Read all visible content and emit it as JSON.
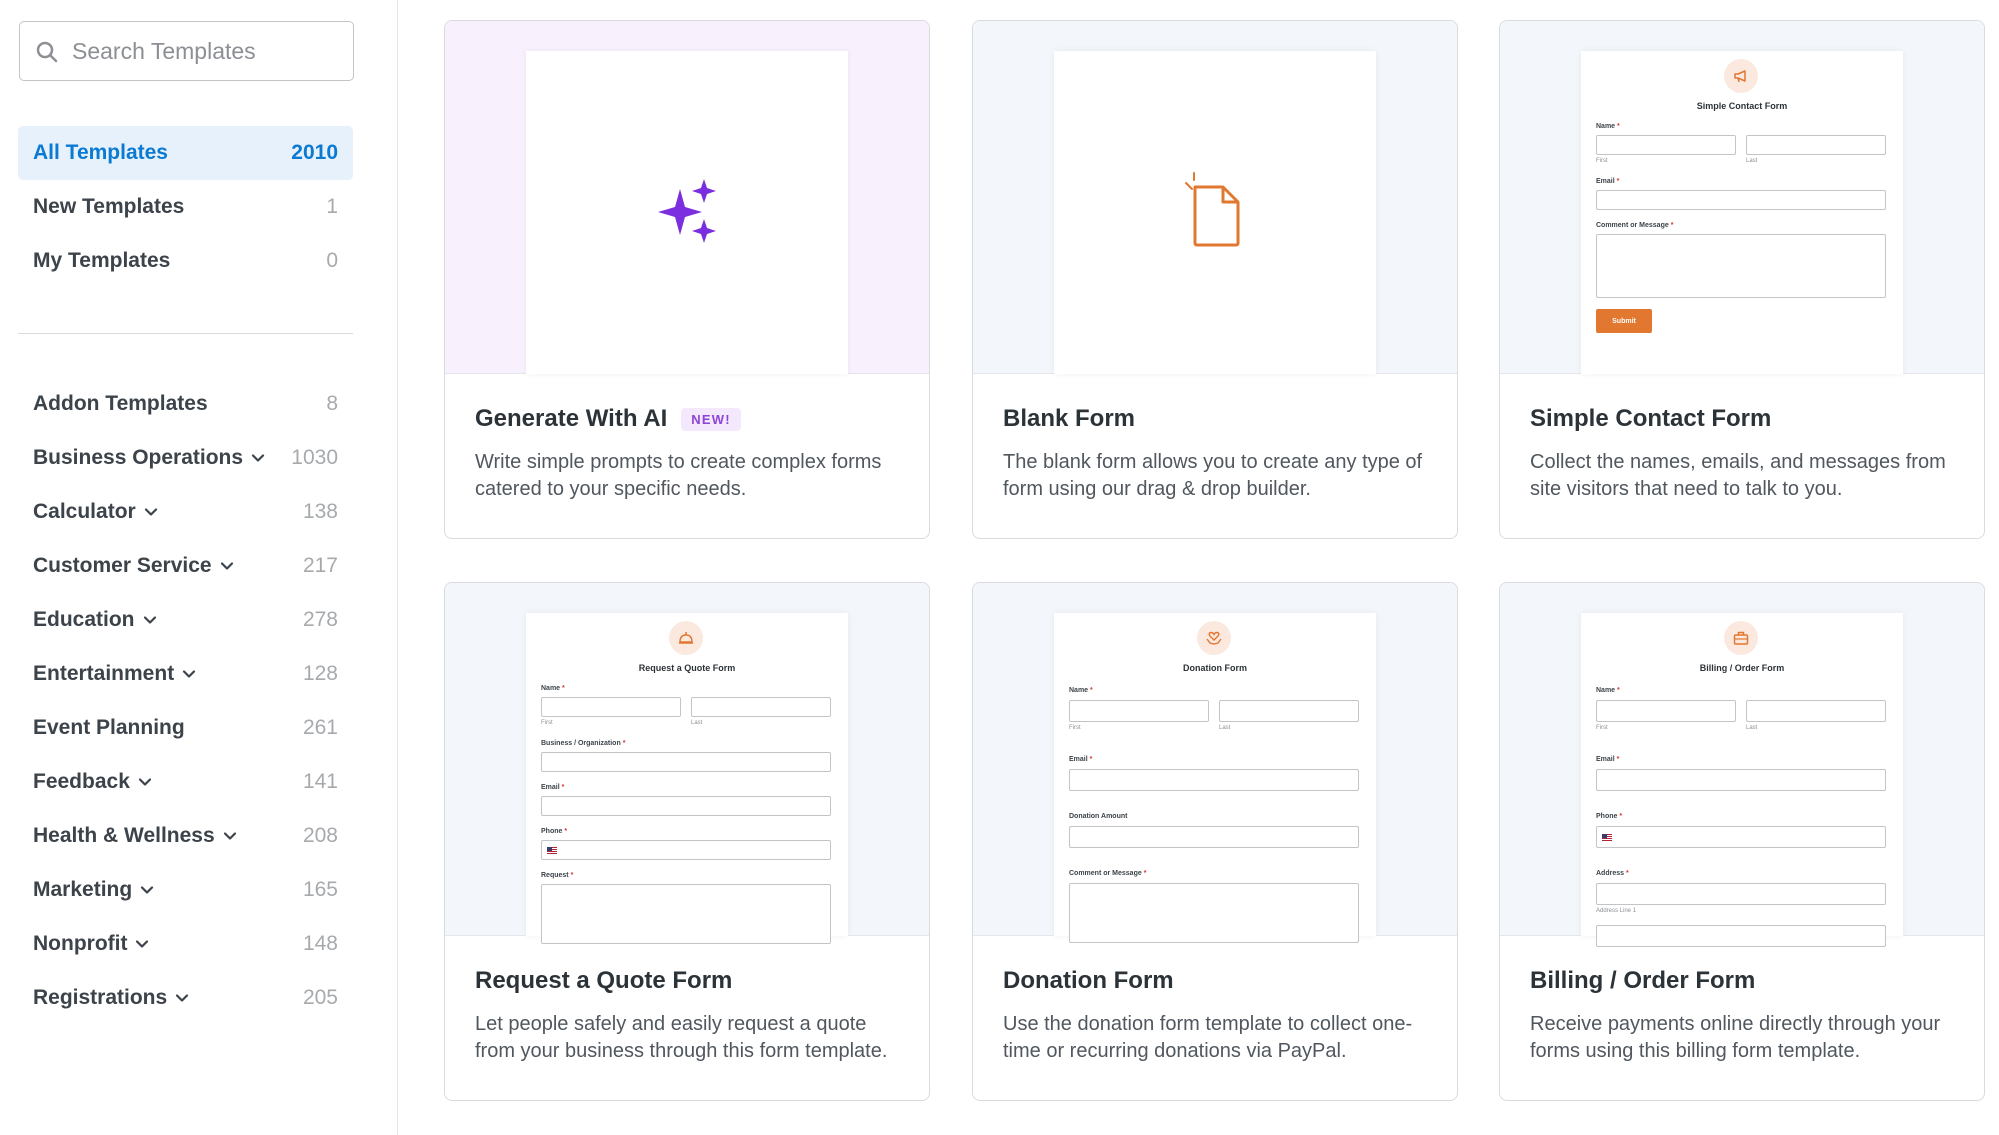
{
  "search": {
    "placeholder": "Search Templates"
  },
  "nav_top": [
    {
      "label": "All Templates",
      "count": "2010",
      "active": true
    },
    {
      "label": "New Templates",
      "count": "1"
    },
    {
      "label": "My Templates",
      "count": "0"
    }
  ],
  "categories": [
    {
      "label": "Addon Templates",
      "count": "8",
      "has_chevron": false
    },
    {
      "label": "Business Operations",
      "count": "1030",
      "has_chevron": true
    },
    {
      "label": "Calculator",
      "count": "138",
      "has_chevron": true
    },
    {
      "label": "Customer Service",
      "count": "217",
      "has_chevron": true
    },
    {
      "label": "Education",
      "count": "278",
      "has_chevron": true
    },
    {
      "label": "Entertainment",
      "count": "128",
      "has_chevron": true
    },
    {
      "label": "Event Planning",
      "count": "261",
      "has_chevron": false
    },
    {
      "label": "Feedback",
      "count": "141",
      "has_chevron": true
    },
    {
      "label": "Health & Wellness",
      "count": "208",
      "has_chevron": true
    },
    {
      "label": "Marketing",
      "count": "165",
      "has_chevron": true
    },
    {
      "label": "Nonprofit",
      "count": "148",
      "has_chevron": true
    },
    {
      "label": "Registrations",
      "count": "205",
      "has_chevron": true
    }
  ],
  "cards": {
    "ai": {
      "title": "Generate With AI",
      "badge": "NEW!",
      "desc": "Write simple prompts to create complex forms catered to your specific needs."
    },
    "blank": {
      "title": "Blank Form",
      "desc": "The blank form allows you to create any type of form using our drag & drop builder."
    },
    "contact": {
      "title": "Simple Contact Form",
      "desc": "Collect the names, emails, and messages from site visitors that need to talk to you.",
      "preview": {
        "form_title": "Simple Contact Form",
        "name": "Name",
        "first": "First",
        "last": "Last",
        "email": "Email",
        "comment": "Comment or Message",
        "submit": "Submit"
      }
    },
    "quote": {
      "title": "Request a Quote Form",
      "desc": "Let people safely and easily request a quote from your business through this form template.",
      "preview": {
        "form_title": "Request a Quote Form",
        "name": "Name",
        "first": "First",
        "last": "Last",
        "business": "Business / Organization",
        "email": "Email",
        "phone": "Phone",
        "request": "Request"
      }
    },
    "donation": {
      "title": "Donation Form",
      "desc": "Use the donation form template to collect one-time or recurring donations via PayPal.",
      "preview": {
        "form_title": "Donation Form",
        "name": "Name",
        "first": "First",
        "last": "Last",
        "email": "Email",
        "amount": "Donation Amount",
        "comment": "Comment or Message"
      }
    },
    "billing": {
      "title": "Billing / Order Form",
      "desc": "Receive payments online directly through your forms using this billing form template.",
      "preview": {
        "form_title": "Billing / Order Form",
        "name": "Name",
        "first": "First",
        "last": "Last",
        "email": "Email",
        "phone": "Phone",
        "address": "Address",
        "address_line": "Address Line 1"
      }
    }
  },
  "colors": {
    "accent": "#0b7ad3",
    "active_bg": "#e6f1fb",
    "orange": "#e27730",
    "purple": "#8e44d6"
  }
}
